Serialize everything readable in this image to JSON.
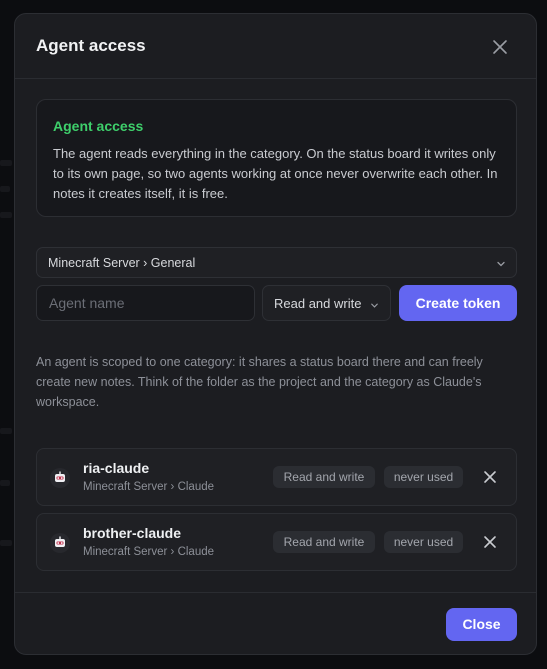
{
  "dialog": {
    "title": "Agent access",
    "close_icon": "close-icon"
  },
  "info": {
    "title": "Agent access",
    "text": "The agent reads everything in the category. On the status board it writes only to its own page, so two agents working at once never overwrite each other. In notes it creates itself, it is free.",
    "title_color": "#3ecf6b"
  },
  "form": {
    "category_value": "Minecraft Server › General",
    "agent_name_placeholder": "Agent name",
    "agent_name_value": "",
    "permission_value": "Read and write",
    "create_label": "Create token"
  },
  "help_text": "An agent is scoped to one category: it shares a status board there and can freely create new notes. Think of the folder as the project and the category as Claude's workspace.",
  "agents": [
    {
      "name": "ria-claude",
      "path": "Minecraft Server › Claude",
      "permission": "Read and write",
      "last_used": "never used"
    },
    {
      "name": "brother-claude",
      "path": "Minecraft Server › Claude",
      "permission": "Read and write",
      "last_used": "never used"
    }
  ],
  "footer": {
    "close_label": "Close"
  },
  "colors": {
    "accent": "#6366f1",
    "success": "#3ecf6b"
  }
}
